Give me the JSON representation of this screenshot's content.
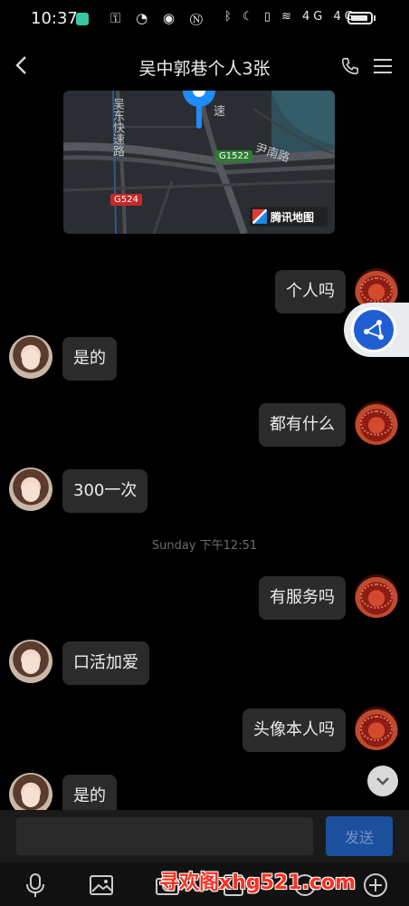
{
  "status_bar": {
    "time": "10:37",
    "icons": [
      "shield-icon",
      "key-icon",
      "speedometer-icon",
      "eye-icon",
      "nfc-icon",
      "bluetooth-icon",
      "moon-icon",
      "vibrate-icon",
      "wifi-icon",
      "signal-icon",
      "signal-icon",
      "battery-icon"
    ],
    "left_glyphs": "⚿ ◔ ◉ Ⓝ",
    "right_glyphs": "ᛒ ☾ ▯ ≋ 4G 4G"
  },
  "header": {
    "title": "吴中郭巷个人3张"
  },
  "map": {
    "labels": {
      "road_vertical": "吴东快速路",
      "road_east": "尹南路",
      "road_top": "速",
      "sign_g1522": "G1522",
      "sign_g524": "G524",
      "brand": "腾讯地图"
    },
    "colors": {
      "background": "#2a2d31",
      "pin": "#1e8bff",
      "sign_green": "#2e7d32",
      "sign_red": "#c62828"
    }
  },
  "messages": [
    {
      "side": "right",
      "text": "个人吗"
    },
    {
      "side": "left",
      "text": "是的"
    },
    {
      "side": "right",
      "text": "都有什么"
    },
    {
      "side": "left",
      "text": "300一次"
    },
    {
      "side": "right",
      "text": "有服务吗"
    },
    {
      "side": "left",
      "text": "口活加爱"
    },
    {
      "side": "right",
      "text": "头像本人吗"
    },
    {
      "side": "left",
      "text": "是的"
    }
  ],
  "timestamp": "Sunday 下午12:51",
  "input": {
    "value": "",
    "placeholder": "",
    "send_label": "发送"
  },
  "toolbar": {
    "icons": [
      "microphone-icon",
      "image-icon",
      "camera-icon",
      "file-icon",
      "emoji-icon",
      "add-icon"
    ]
  },
  "watermark": "寻欢阁xhg521.com",
  "colors": {
    "background": "#000000",
    "bubble": "#2b2b2b",
    "send_button": "#1c4f9c"
  }
}
